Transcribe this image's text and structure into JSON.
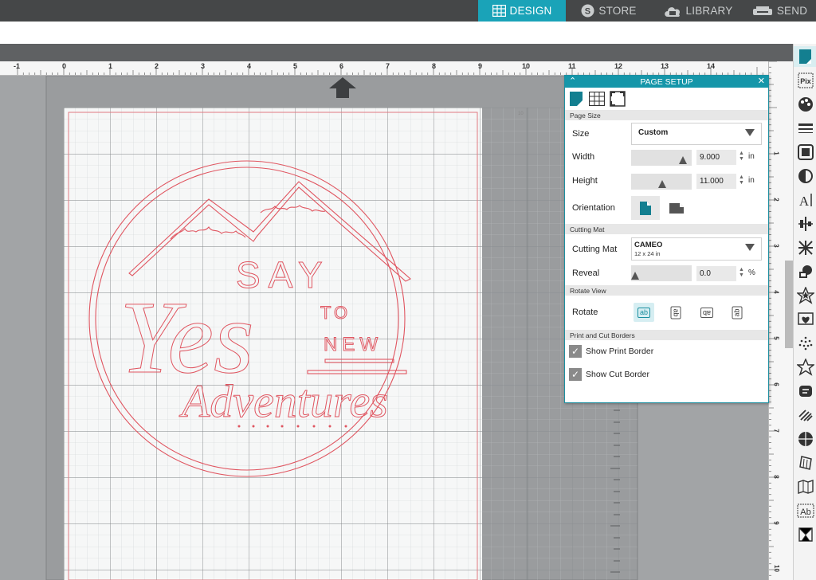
{
  "topnav": {
    "tabs": [
      {
        "label": "DESIGN",
        "icon": "grid-icon",
        "active": true
      },
      {
        "label": "STORE",
        "icon": "store-s-icon",
        "active": false
      },
      {
        "label": "LIBRARY",
        "icon": "cloud-library-icon",
        "active": false
      },
      {
        "label": "SEND",
        "icon": "printer-send-icon",
        "active": false
      }
    ]
  },
  "ruler": {
    "horizontal": [
      "-1",
      "0",
      "1",
      "2",
      "3",
      "4",
      "5",
      "6",
      "7",
      "8",
      "9",
      "10",
      "11",
      "12",
      "13",
      "14"
    ],
    "vertical": [
      "1",
      "2",
      "3",
      "4",
      "5",
      "6",
      "7",
      "8",
      "9",
      "10"
    ]
  },
  "canvas": {
    "design_text": {
      "line1": "SAY",
      "line2": "Yes",
      "line3": "TO",
      "line4": "NEW",
      "line5": "Adventures"
    },
    "mat_label": "10"
  },
  "page_setup": {
    "title": "PAGE SETUP",
    "sections": {
      "page_size": "Page Size",
      "cutting_mat": "Cutting Mat",
      "rotate_view": "Rotate View",
      "print_cut_borders": "Print and Cut Borders"
    },
    "size_label": "Size",
    "size_value": "Custom",
    "width_label": "Width",
    "width_value": "9.000",
    "width_unit": "in",
    "height_label": "Height",
    "height_value": "11.000",
    "height_unit": "in",
    "orientation_label": "Orientation",
    "cutting_mat_label": "Cutting Mat",
    "cutting_mat_value": "CAMEO",
    "cutting_mat_sub": "12 x 24 in",
    "reveal_label": "Reveal",
    "reveal_value": "0.0",
    "reveal_unit": "%",
    "rotate_label": "Rotate",
    "rotate_glyph": "ab",
    "show_print_border": "Show Print Border",
    "show_cut_border": "Show Cut Border"
  },
  "right_tools": {
    "icons": [
      "page-setup-icon",
      "pixscan-icon",
      "design-fill-icon",
      "line-style-icon",
      "image-effects-icon",
      "half-circle-icon",
      "text-style-icon",
      "align-icon",
      "replicate-icon",
      "modify-icon",
      "offset-icon",
      "trace-icon",
      "sketch-icon",
      "star-icon",
      "knife-icon",
      "hatch-icon",
      "stitch-icon",
      "warp-icon",
      "fold-icon",
      "text-frame-icon",
      "library-tool-icon"
    ]
  },
  "colors": {
    "accent": "#1aa3b8",
    "design_lines": "#e05560",
    "topbar": "#454748"
  }
}
